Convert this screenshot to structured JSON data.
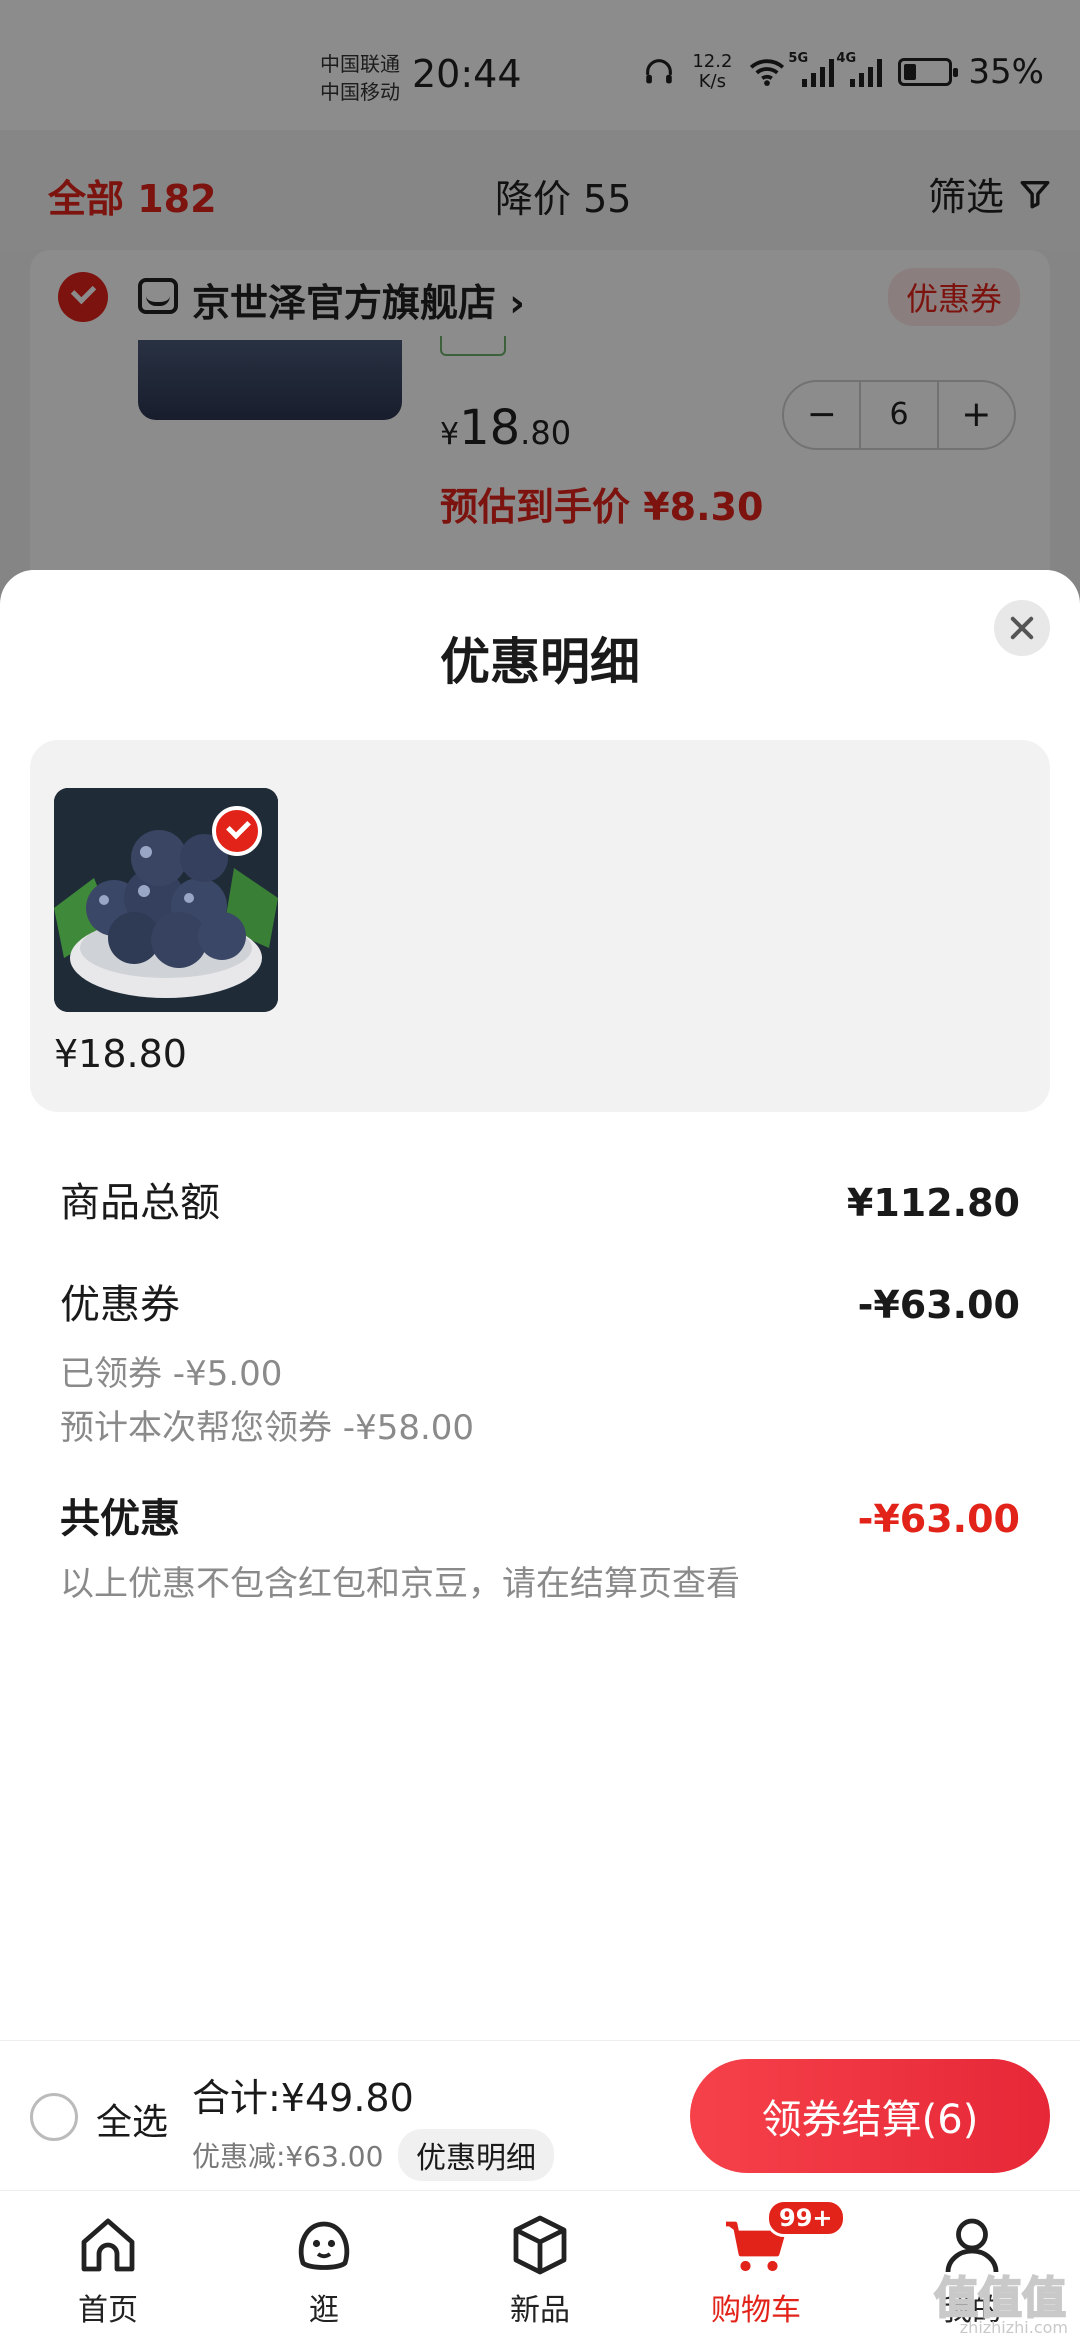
{
  "status_bar": {
    "carrier_1": "中国联通",
    "carrier_2": "中国移动",
    "time": "20:44",
    "net_speed_value": "12.2",
    "net_speed_unit": "K/s",
    "sig1_label": "5G",
    "sig2_label": "4G",
    "battery": "35%"
  },
  "filter_bar": {
    "all_label": "全部 182",
    "price_drop_label": "降价 55",
    "filter_label": "筛选"
  },
  "cart_item": {
    "shop_name": "京世泽官方旗舰店",
    "shop_arrow": "›",
    "coupon_chip": "优惠券",
    "price_symbol": "¥",
    "price_int": "18",
    "price_dec": ".80",
    "qty_minus": "−",
    "qty_value": "6",
    "qty_plus": "+",
    "est_price": "预估到手价 ¥8.30"
  },
  "sheet": {
    "title": "优惠明细",
    "item_price": "¥18.80",
    "goods_total_label": "商品总额",
    "goods_total_value": "¥112.80",
    "coupon_label": "优惠券",
    "coupon_value": "-¥63.00",
    "claimed_line": "已领券 -¥5.00",
    "auto_claim_line": "预计本次帮您领券 -¥58.00",
    "total_discount_label": "共优惠",
    "total_discount_value": "-¥63.00",
    "note": "以上优惠不包含红包和京豆，请在结算页查看"
  },
  "settle_bar": {
    "select_all": "全选",
    "total": "合计:¥49.80",
    "discount": "优惠减:¥63.00",
    "detail_chip": "优惠明细",
    "checkout": "领券结算(6)"
  },
  "tab_bar": {
    "home": "首页",
    "browse": "逛",
    "new": "新品",
    "cart": "购物车",
    "cart_badge": "99+",
    "me": "我的"
  },
  "watermark": {
    "text": "值值值",
    "sub": "zhizhizhi.com"
  },
  "colors": {
    "accent_red": "#e2231a",
    "checkout_gradient_start": "#f6414a",
    "checkout_gradient_end": "#e62737",
    "panel_gray": "#f2f2f2"
  }
}
